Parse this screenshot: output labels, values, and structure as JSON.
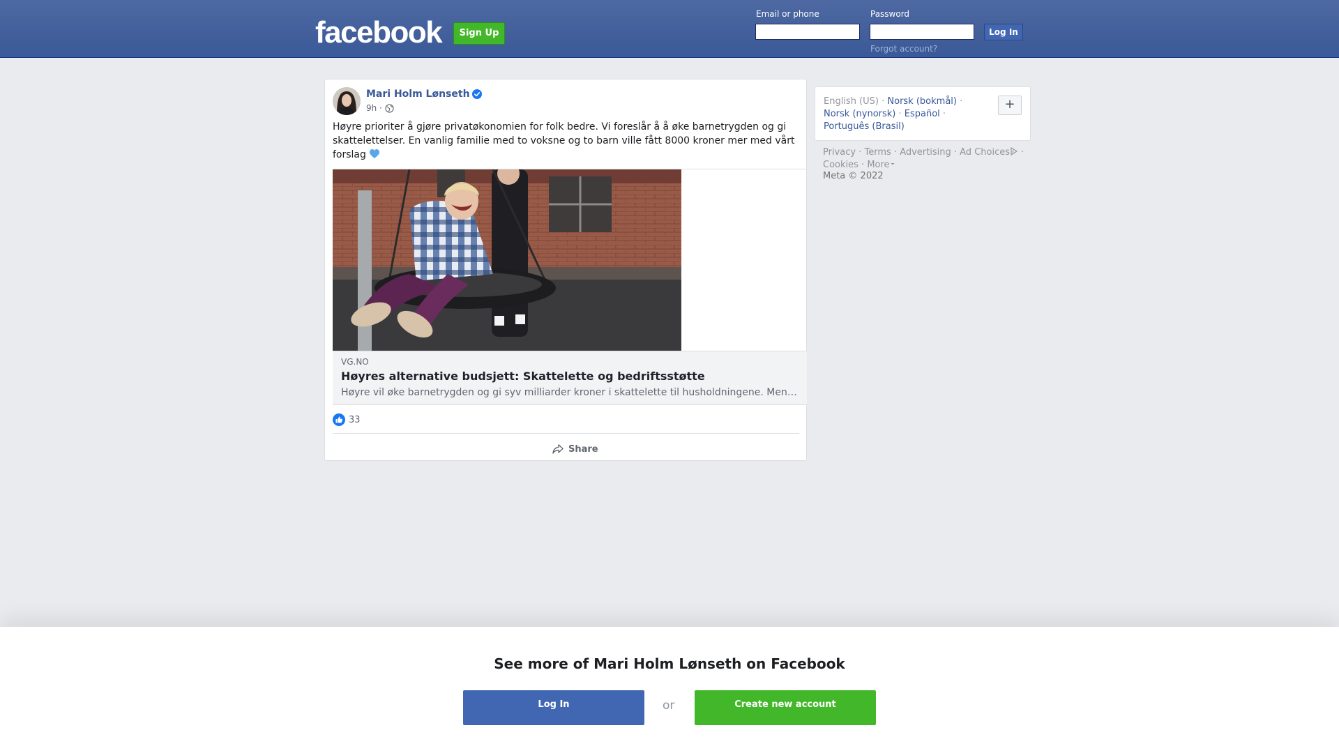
{
  "header": {
    "logo": "facebook",
    "signup_label": "Sign Up",
    "email_label": "Email or phone",
    "password_label": "Password",
    "login_label": "Log In",
    "forgot_label": "Forgot account?"
  },
  "post": {
    "author": "Mari Holm Lønseth",
    "time": "9h ·",
    "text": "Høyre prioriter å gjøre privatøkonomien for folk bedre. Vi foreslår å å øke barnetrygden og gi skattelettelser. En vanlig familie med to voksne og to barn ville fått 8000 kroner mer med vårt forslag",
    "link": {
      "domain": "VG.NO",
      "title": "Høyres alternative budsjett: Skattelette og bedriftsstøtte",
      "description": "Høyre vil øke barnetrygden og gi syv milliarder kroner i skattelette til husholdningene. Men…"
    },
    "like_count": "33",
    "share_label": "Share"
  },
  "sidebar": {
    "languages": {
      "current": "English (US) ·",
      "norsk_bokmal": "Norsk (bokmål)",
      "norsk_nynorsk": "Norsk (nynorsk)",
      "espanol": "Español",
      "portugues": "Português (Brasil)"
    },
    "plus_label": "+",
    "footer": {
      "privacy": "Privacy",
      "terms": "Terms",
      "advertising": "Advertising",
      "ad_choices": "Ad Choices",
      "cookies": "Cookies",
      "more": "More",
      "copyright": "Meta © 2022"
    }
  },
  "bottom": {
    "title": "See more of Mari Holm Lønseth on Facebook",
    "login_label": "Log In",
    "or_label": "or",
    "create_label": "Create new account"
  },
  "colors": {
    "brand_blue": "#3b5998",
    "button_green": "#42b72a",
    "link_blue": "#385898",
    "verified_blue": "#1877f2"
  }
}
